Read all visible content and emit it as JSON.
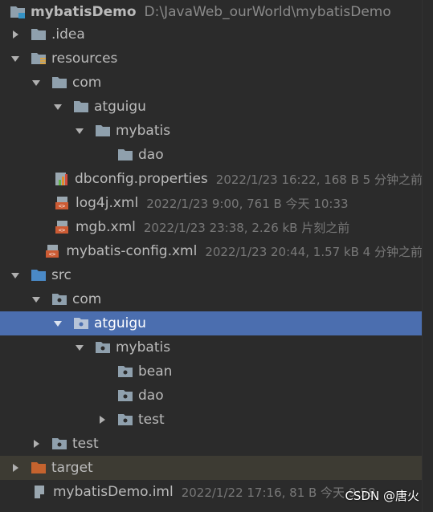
{
  "project": {
    "name": "mybatisDemo",
    "path": "D:\\JavaWeb_ourWorld\\mybatisDemo"
  },
  "nodes": {
    "idea": {
      "label": ".idea"
    },
    "resources": {
      "label": "resources"
    },
    "res_com": {
      "label": "com"
    },
    "res_atguigu": {
      "label": "atguigu"
    },
    "res_mybatis": {
      "label": "mybatis"
    },
    "res_dao": {
      "label": "dao"
    },
    "dbconfig": {
      "label": "dbconfig.properties",
      "meta": "2022/1/23 16:22, 168 B 5 分钟之前"
    },
    "log4j": {
      "label": "log4j.xml",
      "meta": "2022/1/23 9:00, 761 B 今天 10:33"
    },
    "mgb": {
      "label": "mgb.xml",
      "meta": "2022/1/23 23:38, 2.26 kB 片刻之前"
    },
    "mybatis_config": {
      "label": "mybatis-config.xml",
      "meta": "2022/1/23 20:44, 1.57 kB 4 分钟之前"
    },
    "src": {
      "label": "src"
    },
    "src_com": {
      "label": "com"
    },
    "src_atguigu": {
      "label": "atguigu"
    },
    "src_mybatis": {
      "label": "mybatis"
    },
    "bean": {
      "label": "bean"
    },
    "src_dao": {
      "label": "dao"
    },
    "src_test": {
      "label": "test"
    },
    "test": {
      "label": "test"
    },
    "target": {
      "label": "target"
    },
    "iml": {
      "label": "mybatisDemo.iml",
      "meta": "2022/1/22 17:16, 81 B 今天 9:58"
    }
  },
  "watermark": "CSDN @唐火",
  "colors": {
    "background": "#2b2b2b",
    "selection": "#4b6eaf",
    "folder": "#8fa0ad",
    "source_folder": "#4a89c6",
    "excluded_folder": "#c5632e",
    "xml_icon": "#cc5b34"
  }
}
